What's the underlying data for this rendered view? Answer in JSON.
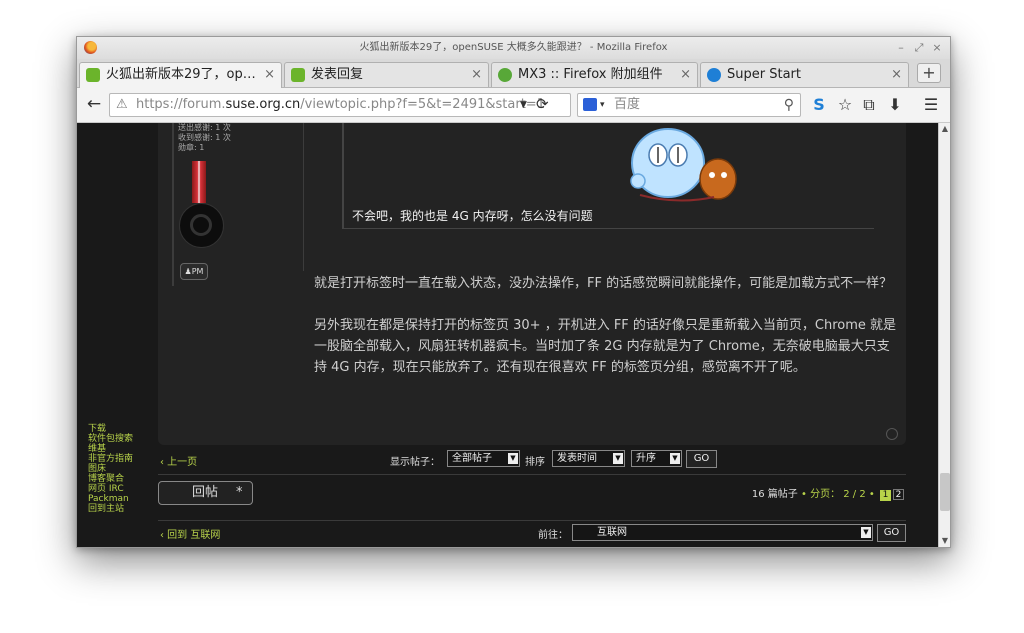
{
  "window": {
    "title": "火狐出新版本29了，openSUSE 大概多久能跟进？ - Mozilla Firefox",
    "controls": [
      "–",
      "⤢",
      "×"
    ]
  },
  "tabs": [
    {
      "label": "火狐出新版本29了，op…",
      "close": "×",
      "icon": "opensuse-icon",
      "color": "#6bb42b"
    },
    {
      "label": "发表回复",
      "close": "×",
      "icon": "opensuse-icon",
      "color": "#6bb42b"
    },
    {
      "label": "MX3 :: Firefox 附加组件",
      "close": "×",
      "icon": "puzzle-icon",
      "color": "#58a838"
    },
    {
      "label": "Super Start",
      "close": "×",
      "icon": "s-icon",
      "color": "#1e7fd6"
    }
  ],
  "newtab": "+",
  "nav": {
    "back": "←",
    "url_prefix": "https://forum.",
    "url_domain": "suse.org.cn",
    "url_path": "/viewtopic.php?f=5&t=2491&start=1",
    "url_dropdown": "▼",
    "reload": "⟳",
    "search_placeholder": "百度",
    "search_dropdown": "▾",
    "search_go": "🔍",
    "toolbar_icons": [
      "S",
      "☆",
      "⧉",
      "⬇",
      "☰"
    ]
  },
  "sidebar_links": [
    "下载",
    "软件包搜索",
    "维基",
    "非官方指南",
    "图床",
    "博客聚合",
    "网页 IRC",
    "Packman",
    "回到主站"
  ],
  "profile": {
    "lines": [
      "送出感谢: 1 次",
      "收到感谢: 1 次",
      "勋章: 1"
    ],
    "pm_label": "PM"
  },
  "quote": {
    "text": "不会吧，我的也是 4G 内存呀，怎么没有问题"
  },
  "post_body": [
    "就是打开标签时一直在载入状态，没办法操作，FF 的话感觉瞬间就能操作，可能是加载方式不一样？",
    "另外我现在都是保持打开的标签页 30+ ，开机进入 FF 的话好像只是重新载入当前页，Chrome 就是一股脑全部载入，风扇狂转机器疯卡。当时加了条 2G 内存就是为了 Chrome，无奈破电脑最大只支持 4G 内存，现在只能放弃了。还有现在很喜欢 FF 的标签页分组，感觉离不开了呢。"
  ],
  "toolbar": {
    "prev_page": "‹ 上一页",
    "display_label": "显示帖子：",
    "display_value": "全部帖子",
    "sort_label": "排序",
    "sort_value": "发表时间",
    "order_value": "升序",
    "go": "GO",
    "dropdown_arrow": "▼"
  },
  "reply": {
    "label": "回帖",
    "star": "*"
  },
  "pagination": {
    "count": "16 篇帖子",
    "sep": "•",
    "pages_label": "分页：",
    "pages_value": "2 / 2",
    "page_links": [
      "1",
      "2"
    ]
  },
  "footer": {
    "back_link": "‹ 回到 互联网",
    "jump_label": "前往：",
    "jump_value": "互联网",
    "go": "GO"
  },
  "scrollbar": {
    "up": "▲",
    "down": "▼"
  }
}
